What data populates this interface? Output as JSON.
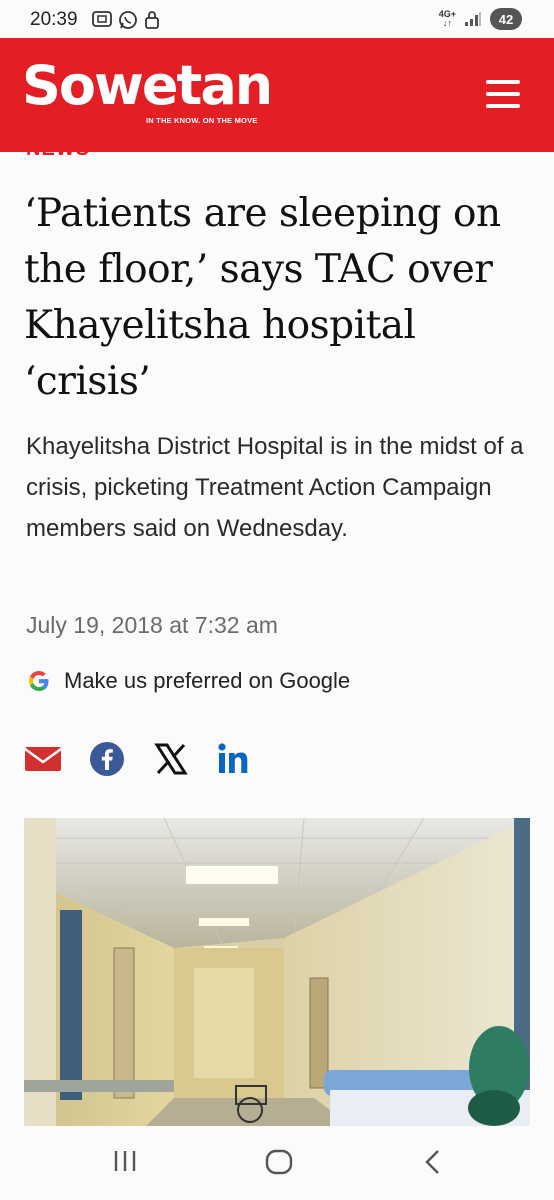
{
  "status": {
    "time": "20:39",
    "network": "4G+",
    "battery": "42"
  },
  "header": {
    "logo_text": "Sowetan",
    "tagline": "IN THE KNOW. ON THE MOVE",
    "brand_color": "#e31e24",
    "menu_icon": "hamburger-menu-icon"
  },
  "article": {
    "section": "NEWS",
    "headline": "‘Patients are sleeping on the floor,’ says TAC over Khayelitsha hospital ‘crisis’",
    "standfirst": "Khayelitsha District Hospital is in the midst of a crisis, picketing Treatment Action Campaign members said on Wednesday.",
    "date": "July 19, 2018 at 7:32 am",
    "google_prompt": "Make us preferred on Google"
  },
  "share": {
    "icons": [
      "email-icon",
      "facebook-icon",
      "x-icon",
      "linkedin-icon"
    ]
  },
  "navbar": {
    "icons": [
      "recent-apps-icon",
      "home-icon",
      "back-icon"
    ]
  }
}
